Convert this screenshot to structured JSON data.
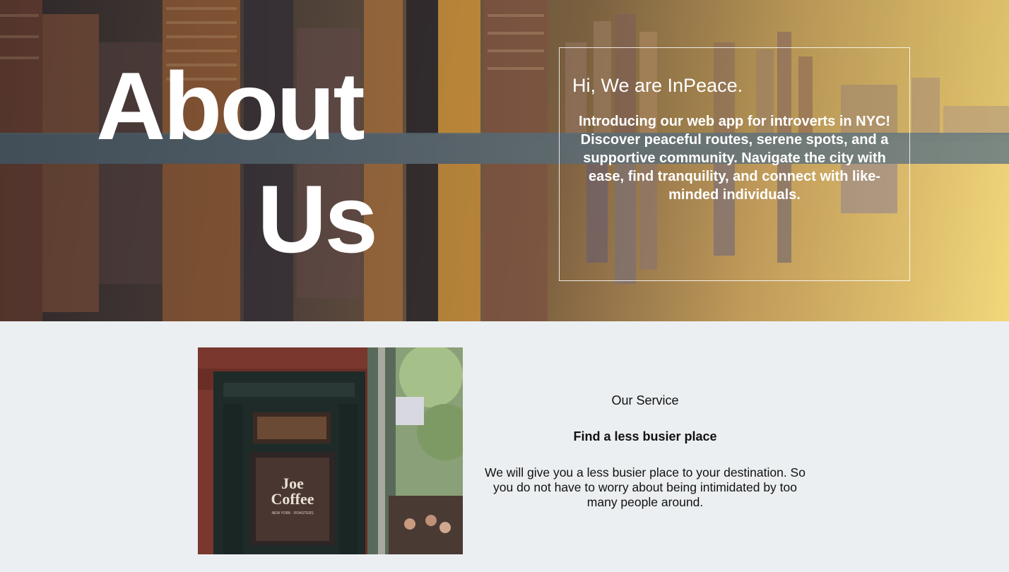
{
  "hero": {
    "title_line1": "About",
    "title_line2": "Us",
    "heading": "Hi, We are InPeace.",
    "intro": "Introducing our web app for introverts in NYC! Discover peaceful routes, serene spots, and a supportive community. Navigate the city with ease, find tranquility, and connect with like-minded individuals."
  },
  "service": {
    "label": "Our Service",
    "title": "Find a less busier place",
    "description": "We will give you a less busier place to your destination. So you do not have to worry about being intimidated by too many people around.",
    "photo_sign": "Joe Coffee",
    "photo_subsign": "NEW YORK · ROASTERS"
  },
  "colors": {
    "text_light": "#ffffff",
    "section_bg": "#eceff1",
    "text_dark": "#111111"
  }
}
